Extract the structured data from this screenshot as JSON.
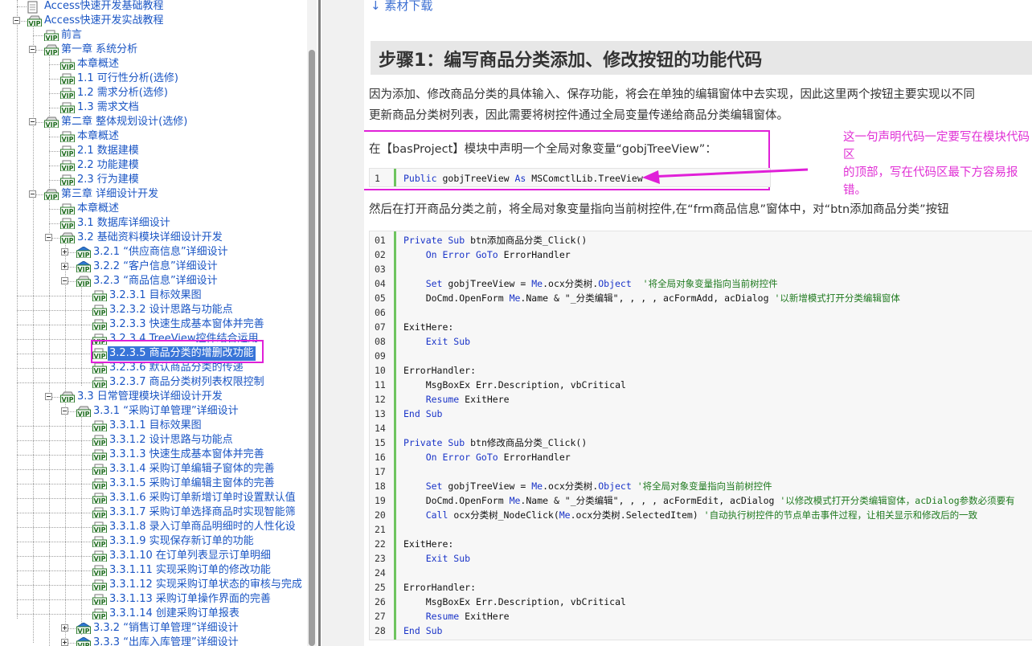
{
  "tree": {
    "items": [
      {
        "label": "Access快速开发基础教程",
        "icon": "book-icon"
      },
      {
        "label": "Access快速开发实战教程",
        "icon": "vip-folder-icon"
      },
      {
        "label": "前言",
        "icon": "vip-page-icon"
      },
      {
        "label": "第一章 系统分析",
        "icon": "vip-folder-icon"
      },
      {
        "label": "本章概述",
        "icon": "vip-page-icon"
      },
      {
        "label": "1.1 可行性分析(选修)",
        "icon": "vip-page-icon"
      },
      {
        "label": "1.2 需求分析(选修)",
        "icon": "vip-page-icon"
      },
      {
        "label": "1.3 需求文档",
        "icon": "vip-page-icon"
      },
      {
        "label": "第二章 整体规划设计(选修)",
        "icon": "vip-folder-icon"
      },
      {
        "label": "本章概述",
        "icon": "vip-page-icon"
      },
      {
        "label": "2.1 数据建模",
        "icon": "vip-page-icon"
      },
      {
        "label": "2.2 功能建模",
        "icon": "vip-page-icon"
      },
      {
        "label": "2.3 行为建模",
        "icon": "vip-page-icon"
      },
      {
        "label": "第三章 详细设计开发",
        "icon": "vip-folder-icon"
      },
      {
        "label": "本章概述",
        "icon": "vip-page-icon"
      },
      {
        "label": "3.1 数据库详细设计",
        "icon": "vip-page-icon"
      },
      {
        "label": "3.2 基础资料模块详细设计开发",
        "icon": "vip-folder-icon"
      },
      {
        "label": "3.2.1 “供应商信息”详细设计",
        "icon": "vip-book-icon"
      },
      {
        "label": "3.2.2 “客户信息”详细设计",
        "icon": "vip-book-icon"
      },
      {
        "label": "3.2.3 “商品信息”详细设计",
        "icon": "vip-folder-icon"
      },
      {
        "label": "3.2.3.1 目标效果图",
        "icon": "vip-page-icon"
      },
      {
        "label": "3.2.3.2 设计思路与功能点",
        "icon": "vip-page-icon"
      },
      {
        "label": "3.2.3.3 快速生成基本窗体并完善",
        "icon": "vip-page-icon"
      },
      {
        "label": "3.2.3.4 TreeView控件结合运用",
        "icon": "vip-page-icon"
      },
      {
        "label": "3.2.3.5 商品分类的增删改功能",
        "icon": "vip-page-icon"
      },
      {
        "label": "3.2.3.6 默认商品分类的传递",
        "icon": "vip-page-icon"
      },
      {
        "label": "3.2.3.7 商品分类树列表权限控制",
        "icon": "vip-page-icon"
      },
      {
        "label": "3.3 日常管理模块详细设计开发",
        "icon": "vip-folder-icon"
      },
      {
        "label": "3.3.1 “采购订单管理”详细设计",
        "icon": "vip-folder-icon"
      },
      {
        "label": "3.3.1.1 目标效果图",
        "icon": "vip-page-icon"
      },
      {
        "label": "3.3.1.2 设计思路与功能点",
        "icon": "vip-page-icon"
      },
      {
        "label": "3.3.1.3 快速生成基本窗体并完善",
        "icon": "vip-page-icon"
      },
      {
        "label": "3.3.1.4 采购订单编辑子窗体的完善",
        "icon": "vip-page-icon"
      },
      {
        "label": "3.3.1.5 采购订单编辑主窗体的完善",
        "icon": "vip-page-icon"
      },
      {
        "label": "3.3.1.6 采购订单新增订单时设置默认值",
        "icon": "vip-page-icon"
      },
      {
        "label": "3.3.1.7 采购订单选择商品时实现智能筛",
        "icon": "vip-page-icon"
      },
      {
        "label": "3.3.1.8 录入订单商品明细时的人性化设",
        "icon": "vip-page-icon"
      },
      {
        "label": "3.3.1.9 实现保存新订单的功能",
        "icon": "vip-page-icon"
      },
      {
        "label": "3.3.1.10 在订单列表显示订单明细",
        "icon": "vip-page-icon"
      },
      {
        "label": "3.3.1.11 实现采购订单的修改功能",
        "icon": "vip-page-icon"
      },
      {
        "label": "3.3.1.12 实现采购订单状态的审核与完成",
        "icon": "vip-page-icon"
      },
      {
        "label": "3.3.1.13 采购订单操作界面的完善",
        "icon": "vip-page-icon"
      },
      {
        "label": "3.3.1.14 创建采购订单报表",
        "icon": "vip-page-icon"
      },
      {
        "label": "3.3.2 “销售订单管理”详细设计",
        "icon": "vip-book-icon"
      },
      {
        "label": "3.3.3 “出库入库管理”详细设计",
        "icon": "vip-book-icon"
      }
    ]
  },
  "content": {
    "download_link": "↓ 素材下载",
    "step_title": "步骤1：编写商品分类添加、修改按钮的功能代码",
    "intro_line1": "因为添加、修改商品分类的具体输入、保存功能，将会在单独的编辑窗体中去实现，因此这里两个按钮主要实现以不同",
    "intro_line2": "更新商品分类树列表，因此需要将树控件通过全局变量传递给商品分类编辑窗体。",
    "declare_text": "在【basProject】模块中声明一个全局对象变量“gobjTreeView”：",
    "annotation_line1": "这一句声明代码一定要写在模块代码区",
    "annotation_line2": "的顶部，写在代码区最下方容易报错。",
    "then_text": "然后在打开商品分类之前，将全局对象变量指向当前树控件,在“frm商品信息”窗体中，对“btn添加商品分类”按钮",
    "decl_code": [
      {
        "n": "1",
        "parts": [
          {
            "t": "Public ",
            "k": "kw"
          },
          {
            "t": "gobjTreeView ",
            "k": ""
          },
          {
            "t": "As ",
            "k": "kw"
          },
          {
            "t": "MSComctlLib.TreeView",
            "k": ""
          }
        ]
      }
    ],
    "code_lines": [
      {
        "n": "01",
        "parts": [
          {
            "t": "Private Sub ",
            "k": "kw"
          },
          {
            "t": "btn添加商品分类_Click()",
            "k": ""
          }
        ]
      },
      {
        "n": "02",
        "parts": [
          {
            "t": "    On Error GoTo ",
            "k": "kw"
          },
          {
            "t": "ErrorHandler",
            "k": ""
          }
        ]
      },
      {
        "n": "03",
        "parts": []
      },
      {
        "n": "04",
        "parts": [
          {
            "t": "    Set ",
            "k": "kw"
          },
          {
            "t": "gobjTreeView = ",
            "k": ""
          },
          {
            "t": "Me",
            "k": "kw"
          },
          {
            "t": ".ocx分类树.",
            "k": ""
          },
          {
            "t": "Object",
            "k": "kw"
          },
          {
            "t": "  ",
            "k": ""
          },
          {
            "t": "'将全局对象变量指向当前树控件",
            "k": "cm"
          }
        ]
      },
      {
        "n": "05",
        "parts": [
          {
            "t": "    DoCmd.OpenForm ",
            "k": ""
          },
          {
            "t": "Me",
            "k": "kw"
          },
          {
            "t": ".Name & \"_分类编辑\", , , , acFormAdd, acDialog ",
            "k": ""
          },
          {
            "t": "'以新增模式打开分类编辑窗体",
            "k": "cm"
          }
        ]
      },
      {
        "n": "06",
        "parts": []
      },
      {
        "n": "07",
        "parts": [
          {
            "t": "ExitHere:",
            "k": ""
          }
        ]
      },
      {
        "n": "08",
        "parts": [
          {
            "t": "    Exit Sub",
            "k": "kw"
          }
        ]
      },
      {
        "n": "09",
        "parts": []
      },
      {
        "n": "10",
        "parts": [
          {
            "t": "ErrorHandler:",
            "k": ""
          }
        ]
      },
      {
        "n": "11",
        "parts": [
          {
            "t": "    MsgBoxEx Err.Description, vbCritical",
            "k": ""
          }
        ]
      },
      {
        "n": "12",
        "parts": [
          {
            "t": "    Resume ",
            "k": "kw"
          },
          {
            "t": "ExitHere",
            "k": ""
          }
        ]
      },
      {
        "n": "13",
        "parts": [
          {
            "t": "End Sub",
            "k": "kw"
          }
        ]
      },
      {
        "n": "14",
        "parts": []
      },
      {
        "n": "15",
        "parts": [
          {
            "t": "Private Sub ",
            "k": "kw"
          },
          {
            "t": "btn修改商品分类_Click()",
            "k": ""
          }
        ]
      },
      {
        "n": "16",
        "parts": [
          {
            "t": "    On Error GoTo ",
            "k": "kw"
          },
          {
            "t": "ErrorHandler",
            "k": ""
          }
        ]
      },
      {
        "n": "17",
        "parts": []
      },
      {
        "n": "18",
        "parts": [
          {
            "t": "    Set ",
            "k": "kw"
          },
          {
            "t": "gobjTreeView = ",
            "k": ""
          },
          {
            "t": "Me",
            "k": "kw"
          },
          {
            "t": ".ocx分类树.",
            "k": ""
          },
          {
            "t": "Object ",
            "k": "kw"
          },
          {
            "t": "'将全局对象变量指向当前树控件",
            "k": "cm"
          }
        ]
      },
      {
        "n": "19",
        "parts": [
          {
            "t": "    DoCmd.OpenForm ",
            "k": ""
          },
          {
            "t": "Me",
            "k": "kw"
          },
          {
            "t": ".Name & \"_分类编辑\", , , , acFormEdit, acDialog ",
            "k": ""
          },
          {
            "t": "'以修改模式打开分类编辑窗体，acDialog参数必须要有",
            "k": "cm"
          }
        ]
      },
      {
        "n": "20",
        "parts": [
          {
            "t": "    Call ",
            "k": "kw"
          },
          {
            "t": "ocx分类树_NodeClick(",
            "k": ""
          },
          {
            "t": "Me",
            "k": "kw"
          },
          {
            "t": ".ocx分类树.SelectedItem) ",
            "k": ""
          },
          {
            "t": "'自动执行树控件的节点单击事件过程，让相关显示和修改后的一致",
            "k": "cm"
          }
        ]
      },
      {
        "n": "21",
        "parts": []
      },
      {
        "n": "22",
        "parts": [
          {
            "t": "ExitHere:",
            "k": ""
          }
        ]
      },
      {
        "n": "23",
        "parts": [
          {
            "t": "    Exit Sub",
            "k": "kw"
          }
        ]
      },
      {
        "n": "24",
        "parts": []
      },
      {
        "n": "25",
        "parts": [
          {
            "t": "ErrorHandler:",
            "k": ""
          }
        ]
      },
      {
        "n": "26",
        "parts": [
          {
            "t": "    MsgBoxEx Err.Description, vbCritical",
            "k": ""
          }
        ]
      },
      {
        "n": "27",
        "parts": [
          {
            "t": "    Resume ",
            "k": "kw"
          },
          {
            "t": "ExitHere",
            "k": ""
          }
        ]
      },
      {
        "n": "28",
        "parts": [
          {
            "t": "End Sub",
            "k": "kw"
          }
        ]
      }
    ]
  },
  "colors": {
    "tree_link": "#1a55c4",
    "selection": "#3874d8",
    "highlight_magenta": "#e020d8",
    "keyword_blue": "#1a34c8",
    "comment_green": "#1f7a1f",
    "gutter_green": "#6ec45f"
  }
}
